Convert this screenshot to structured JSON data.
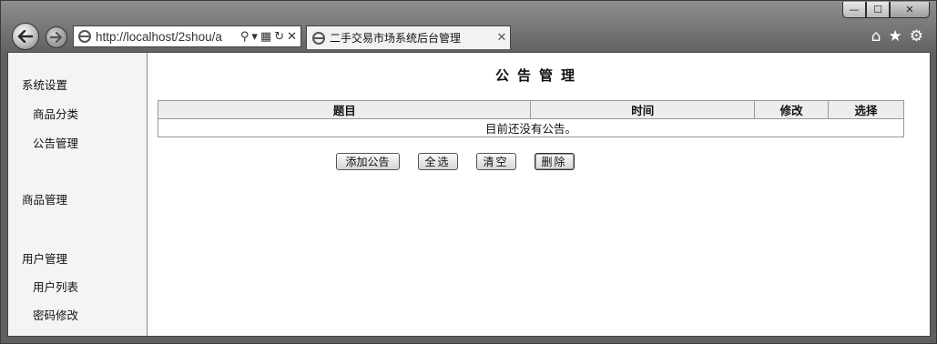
{
  "browser": {
    "url": "http://localhost/2shou/a",
    "tab_title": "二手交易市场系统后台管理",
    "tab_close": "✕",
    "icons": [
      "back-icon",
      "forward-icon",
      "ie-icon",
      "search-icon",
      "compat-icon",
      "refresh-icon",
      "stop-icon",
      "home-icon",
      "favorites-icon",
      "settings-icon"
    ],
    "caption": {
      "min": "—",
      "max": "☐",
      "close": "✕"
    }
  },
  "sidebar": {
    "items": [
      {
        "label": "系统设置"
      },
      {
        "label": "商品分类"
      },
      {
        "label": "公告管理"
      },
      {
        "label": "商品管理"
      },
      {
        "label": "用户管理"
      },
      {
        "label": "用户列表"
      },
      {
        "label": "密码修改"
      }
    ]
  },
  "main": {
    "title": "公告管理",
    "table": {
      "headers": [
        "题目",
        "时间",
        "修改",
        "选择"
      ],
      "empty_message": "目前还没有公告。"
    },
    "buttons": {
      "add": "添加公告",
      "select_all": "全选",
      "clear": "清空",
      "delete": "删除"
    }
  }
}
